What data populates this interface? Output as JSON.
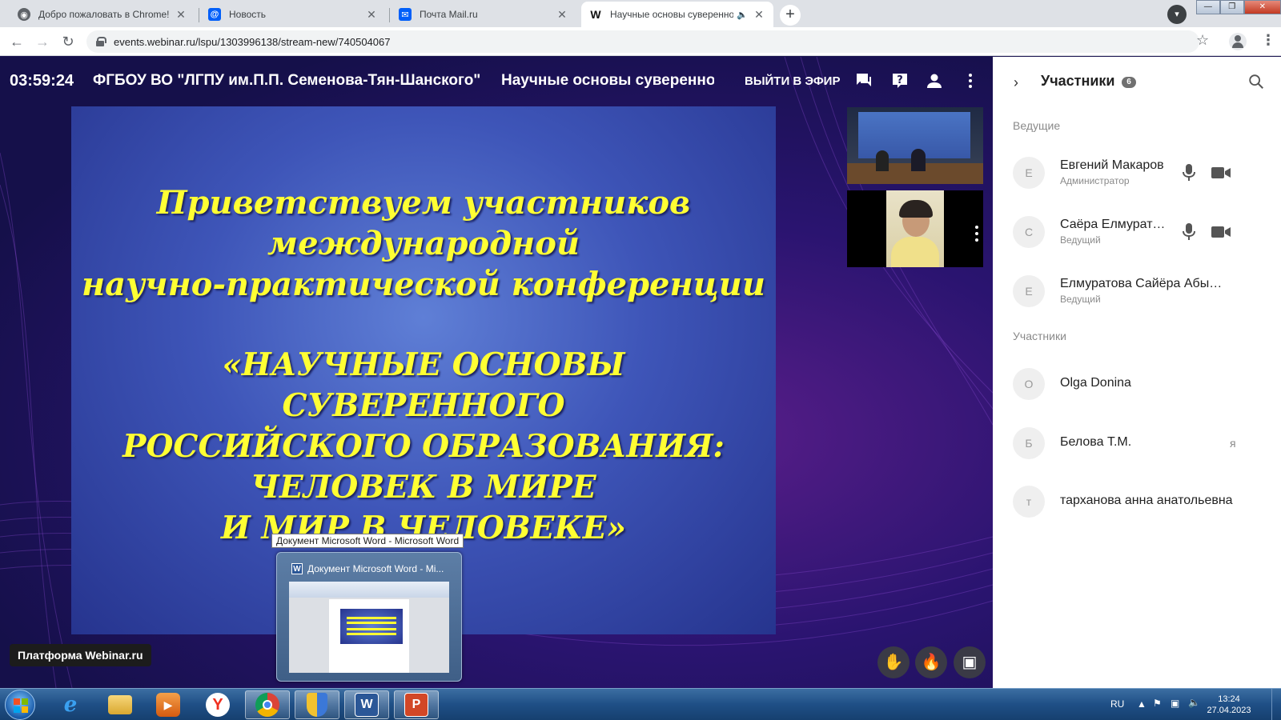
{
  "browser": {
    "tabs": [
      {
        "label": "Добро пожаловать в Chrome!",
        "icon": "chrome-icon"
      },
      {
        "label": "Новость",
        "icon": "mail-at-icon"
      },
      {
        "label": "Почта Mail.ru",
        "icon": "mail-envelope-icon"
      },
      {
        "label": "Научные основы суверенно",
        "icon": "webinar-w-icon",
        "active": true
      }
    ],
    "url": "events.webinar.ru/lspu/1303996138/stream-new/740504067"
  },
  "stage": {
    "timer": "03:59:24",
    "organization": "ФГБОУ ВО \"ЛГПУ им.П.П. Семенова-Тян-Шанского\"",
    "event_title": "Научные основы суверенного",
    "onair_label": "ВЫЙТИ В ЭФИР",
    "brand_label": "Платформа Webinar.ru"
  },
  "slide": {
    "lines_top": [
      "Приветствуем участников",
      "международной",
      "научно-практической конференции"
    ],
    "lines_bottom": [
      "«НАУЧНЫЕ ОСНОВЫ",
      "СУВЕРЕННОГО",
      "РОССИЙСКОГО ОБРАЗОВАНИЯ:",
      "ЧЕЛОВЕК В МИРЕ",
      "И МИР В ЧЕЛОВЕКЕ»"
    ],
    "text_color": "#ffff33"
  },
  "taskbar_preview": {
    "tooltip": "Документ Microsoft Word - Microsoft Word",
    "title": "Документ Microsoft Word - Mi..."
  },
  "panel": {
    "title": "Участники",
    "count": "6",
    "hosts_label": "Ведущие",
    "participants_label": "Участники",
    "hosts": [
      {
        "initial": "Е",
        "name": "Евгений Макаров",
        "role": "Администратор",
        "mic": true,
        "cam": true
      },
      {
        "initial": "С",
        "name": "Саёра Елмуратова",
        "role": "Ведущий",
        "mic": true,
        "cam": true
      },
      {
        "initial": "Е",
        "name": "Елмуратова Сайёра Абылаевна",
        "role": "Ведущий",
        "mic": false,
        "cam": false
      }
    ],
    "participants": [
      {
        "initial": "O",
        "name": "Olga Donina",
        "note": ""
      },
      {
        "initial": "Б",
        "name": "Белова Т.М.",
        "note": "я"
      },
      {
        "initial": "т",
        "name": "тарханова анна анатольевна",
        "note": ""
      }
    ]
  },
  "taskbar": {
    "language": "RU",
    "time": "13:24",
    "date": "27.04.2023",
    "apps": [
      "internet-explorer-icon",
      "file-explorer-icon",
      "media-player-icon",
      "yandex-browser-icon",
      "chrome-icon",
      "security-shield-icon",
      "word-icon",
      "powerpoint-icon"
    ]
  }
}
